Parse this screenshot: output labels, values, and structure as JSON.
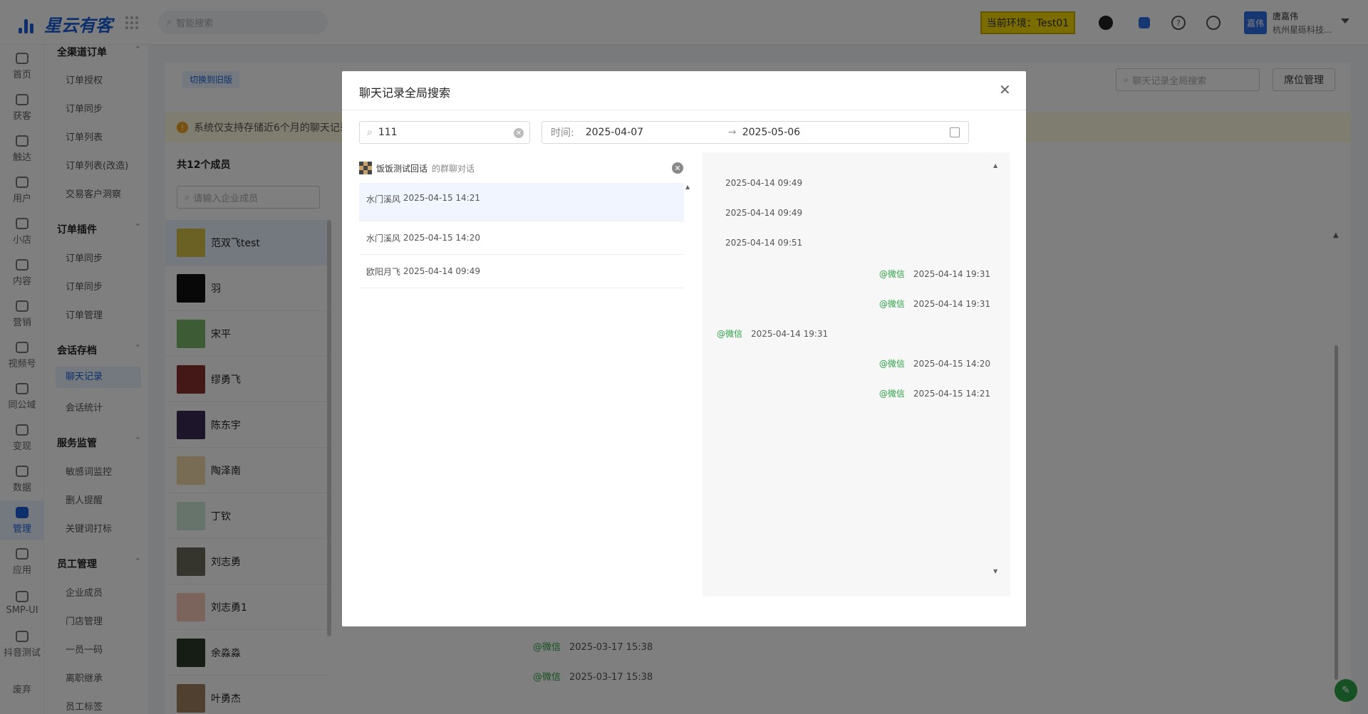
{
  "topbar": {
    "logo_text": "星云有客",
    "search_placeholder": "智能搜索",
    "env_label": "当前环境：Test01",
    "user_avatar_text": "嘉伟",
    "user_name": "唐嘉伟",
    "user_org": "杭州星砾科技..."
  },
  "leftnav": [
    {
      "label": "首页",
      "icon": "home-icon"
    },
    {
      "label": "获客",
      "icon": "acquire-icon"
    },
    {
      "label": "触达",
      "icon": "send-icon"
    },
    {
      "label": "用户",
      "icon": "user-icon"
    },
    {
      "label": "小店",
      "icon": "shop-icon"
    },
    {
      "label": "内容",
      "icon": "folder-icon"
    },
    {
      "label": "营销",
      "icon": "marketing-icon"
    },
    {
      "label": "视频号",
      "icon": "video-icon"
    },
    {
      "label": "同公域",
      "icon": "domain-icon"
    },
    {
      "label": "变现",
      "icon": "cash-icon"
    },
    {
      "label": "数据",
      "icon": "chart-icon"
    },
    {
      "label": "管理",
      "icon": "grid-icon",
      "active": true
    },
    {
      "label": "应用",
      "icon": "app-icon"
    },
    {
      "label": "SMP-UI",
      "icon": "smp-icon"
    },
    {
      "label": "抖音测试",
      "icon": "edit-icon"
    },
    {
      "label": "废弃",
      "icon": "trash-icon"
    }
  ],
  "submenu": {
    "groups": [
      {
        "title": "全渠道订单",
        "items": [
          "订单授权",
          "订单同步",
          "订单列表",
          "订单列表(改造)",
          "交易客户洞察"
        ]
      },
      {
        "title": "订单插件",
        "items": [
          "订单同步",
          "订单同步",
          "订单管理"
        ]
      },
      {
        "title": "会话存档",
        "items": [
          "聊天记录",
          "会话统计"
        ]
      },
      {
        "title": "服务监管",
        "items": [
          "敏感词监控",
          "删人提醒",
          "关键词打标"
        ]
      },
      {
        "title": "员工管理",
        "items": [
          "企业成员",
          "门店管理",
          "一员一码",
          "离职继承",
          "员工标签"
        ]
      }
    ]
  },
  "content": {
    "switch_label": "切换到旧版",
    "global_search_placeholder": "聊天记录全局搜索",
    "seat_button": "席位管理",
    "notice": "系统仅支持存储近6个月的聊天记录",
    "members_count": "共12个成员",
    "member_search_placeholder": "请输入企业成员",
    "members": [
      "范双飞test",
      "羽",
      "宋平",
      "缪勇飞",
      "陈东宇",
      "陶泽南",
      "丁钦",
      "刘志勇",
      "刘志勇1",
      "余淼淼",
      "叶勇杰"
    ],
    "bg_chat": [
      {
        "tag": "@微信",
        "time": "2025-03-17 15:38"
      },
      {
        "tag": "@微信",
        "time": "2025-03-17 15:38"
      }
    ]
  },
  "modal": {
    "title": "聊天记录全局搜索",
    "keyword": "111",
    "time_label": "时间:",
    "date_from": "2025-04-07",
    "date_arrow": "→",
    "date_to": "2025-05-06",
    "group_name": "饭饭测试回话",
    "group_suffix": "的群聊对话",
    "results": [
      {
        "sender": "水门溪风",
        "time": "2025-04-15 14:21"
      },
      {
        "sender": "水门溪风",
        "time": "2025-04-15 14:20"
      },
      {
        "sender": "欧阳月飞",
        "time": "2025-04-14 09:49"
      }
    ],
    "chat": [
      {
        "side": "left",
        "tag": "",
        "time": "2025-04-14 09:49"
      },
      {
        "side": "left",
        "tag": "",
        "time": "2025-04-14 09:49"
      },
      {
        "side": "left",
        "tag": "",
        "time": "2025-04-14 09:51"
      },
      {
        "side": "right",
        "tag": "@微信",
        "time": "2025-04-14 19:31"
      },
      {
        "side": "right",
        "tag": "@微信",
        "time": "2025-04-14 19:31"
      },
      {
        "side": "left",
        "tag": "@微信",
        "time": "2025-04-14 19:31"
      },
      {
        "side": "right",
        "tag": "@微信",
        "time": "2025-04-15 14:20"
      },
      {
        "side": "right",
        "tag": "@微信",
        "time": "2025-04-15 14:21"
      }
    ]
  },
  "colors": {
    "accent": "#1b5fd6",
    "env": "#f7d800",
    "wechat": "#2ba245",
    "overlay": "rgba(0,0,0,0.5)"
  }
}
